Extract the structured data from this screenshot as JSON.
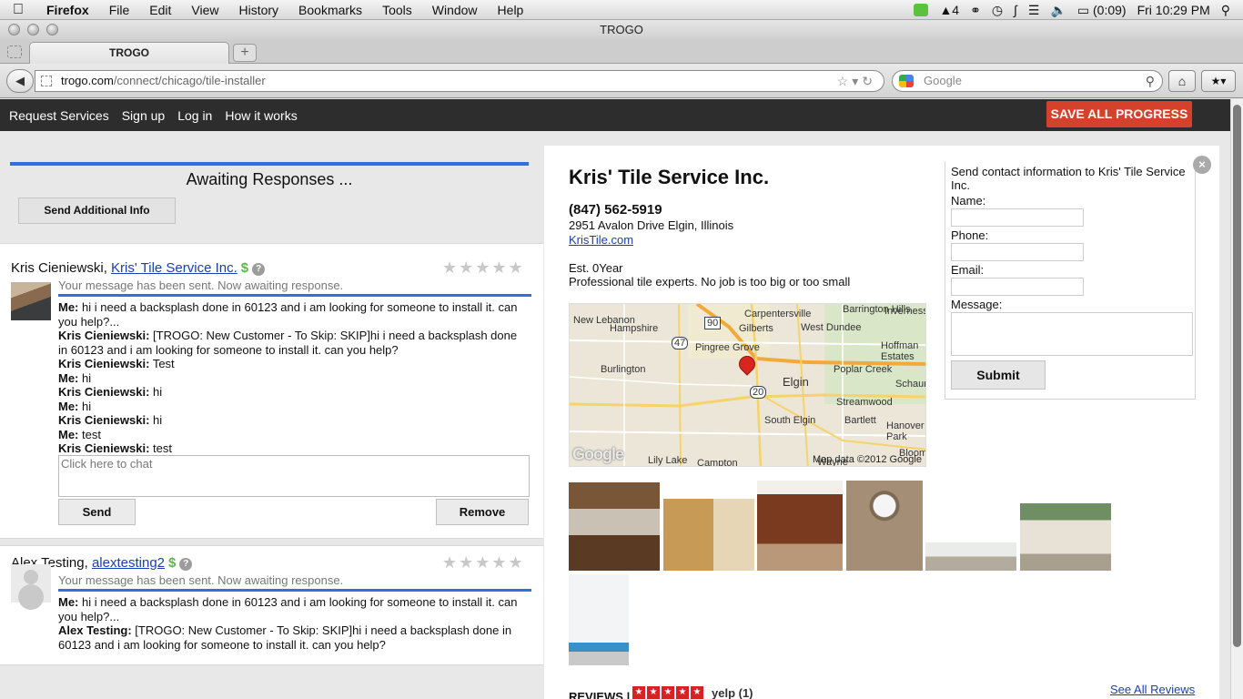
{
  "menubar": {
    "items": [
      "Firefox",
      "File",
      "Edit",
      "View",
      "History",
      "Bookmarks",
      "Tools",
      "Window",
      "Help"
    ],
    "battery": "(0:09)",
    "clock": "Fri 10:29 PM",
    "adobe_count": "4"
  },
  "window": {
    "title": "TROGO"
  },
  "tabs": [
    {
      "label": "TROGO"
    }
  ],
  "urlbar": {
    "host": "trogo.com",
    "path": "/connect/chicago/tile-installer"
  },
  "search": {
    "placeholder": "Google"
  },
  "site_nav": {
    "links": [
      "Request Services",
      "Sign up",
      "Log in",
      "How it works"
    ],
    "save_label": "SAVE ALL PROGRESS"
  },
  "left": {
    "awaiting_title": "Awaiting Responses ...",
    "send_info_label": "Send Additional Info"
  },
  "providers": [
    {
      "name": "Kris Cieniewski,",
      "company": "Kris' Tile Service Inc.",
      "status": "Your message has been sent. Now awaiting response.",
      "messages": [
        {
          "from": "Me:",
          "text": " hi i need a backsplash done in 60123 and i am looking for someone to install it. can you help?..."
        },
        {
          "from": "Kris Cieniewski:",
          "text": " [TROGO: New Customer - To Skip: SKIP]hi i need a backsplash done in 60123 and i am looking for someone to install it. can you help?"
        },
        {
          "from": "Kris Cieniewski:",
          "text": " Test"
        },
        {
          "from": "Me:",
          "text": " hi"
        },
        {
          "from": "Kris Cieniewski:",
          "text": " hi"
        },
        {
          "from": "Me:",
          "text": " hi"
        },
        {
          "from": "Kris Cieniewski:",
          "text": " hi"
        },
        {
          "from": "Me:",
          "text": " test"
        },
        {
          "from": "Kris Cieniewski:",
          "text": " test"
        }
      ],
      "chat_placeholder": "Click here to chat",
      "send_label": "Send",
      "remove_label": "Remove"
    },
    {
      "name": "Alex Testing,",
      "company": "alextesting2",
      "status": "Your message has been sent. Now awaiting response.",
      "messages": [
        {
          "from": "Me:",
          "text": " hi i need a backsplash done in 60123 and i am looking for someone to install it. can you help?..."
        },
        {
          "from": "Alex Testing:",
          "text": " [TROGO: New Customer - To Skip: SKIP]hi i need a backsplash done in 60123 and i am looking for someone to install it. can you help?"
        }
      ]
    }
  ],
  "business": {
    "name": "Kris' Tile Service Inc.",
    "phone": "(847) 562-5919",
    "address": "2951 Avalon Drive Elgin, Illinois",
    "website": "KrisTile.com",
    "established": "Est. 0Year",
    "description": "Professional tile experts. No job is too big or too small",
    "reviews_label": "REVIEWS |",
    "yelp_label": "yelp (1)",
    "see_all_label": "See All Reviews"
  },
  "map": {
    "labels": [
      "New Lebanon",
      "Hampshire",
      "Carpentersville",
      "Barrington Hills",
      "Inverness",
      "Gilberts",
      "West Dundee",
      "Pingree Grove",
      "Hoffman Estates",
      "Burlington",
      "Elgin",
      "Poplar Creek",
      "Schaumburg",
      "Streamwood",
      "South Elgin",
      "Bartlett",
      "Hanover Park",
      "Lily Lake",
      "Campton",
      "Wayne",
      "Bloomingdale"
    ],
    "highways": [
      "90",
      "47",
      "20"
    ],
    "copyright": "Map data ©2012 Google",
    "logo": "Google"
  },
  "contact_form": {
    "heading": "Send contact information to Kris' Tile Service Inc.",
    "name_label": "Name:",
    "phone_label": "Phone:",
    "email_label": "Email:",
    "message_label": "Message:",
    "submit_label": "Submit"
  },
  "colors": {
    "accent_blue": "#2f6fe0",
    "save_red": "#d6412b",
    "header_dark": "#2d2d2d",
    "link_blue": "#1a3fb0"
  }
}
